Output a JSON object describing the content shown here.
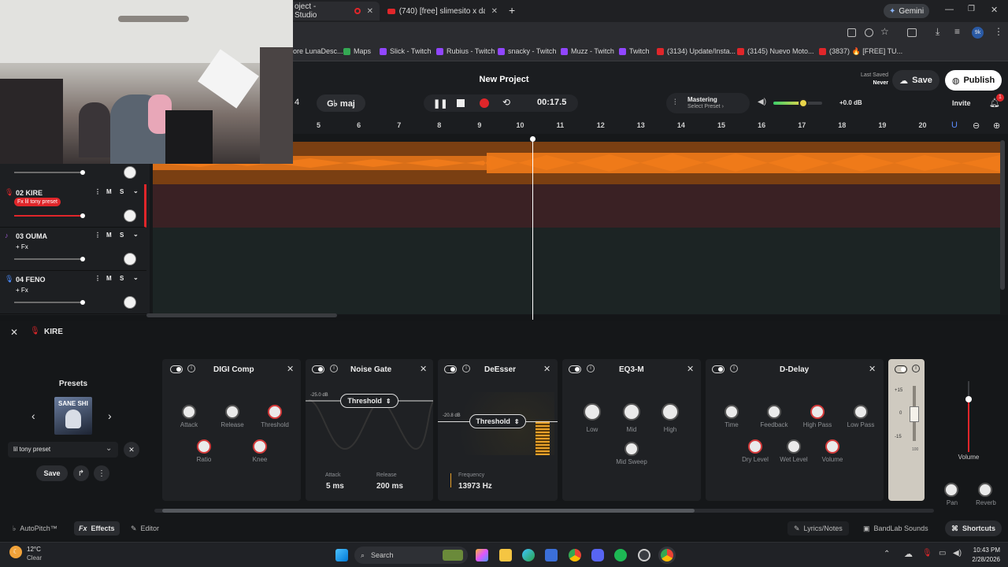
{
  "browser": {
    "tabs": [
      {
        "label": "oject - Studio",
        "active": true
      },
      {
        "label": "(740) [free] slimesito x dark plu",
        "active": false
      }
    ],
    "gemini_label": "Gemini",
    "profile_initials": "9k",
    "bookmarks": [
      "ore LunaDesc...",
      "Maps",
      "Slick - Twitch",
      "Rubius - Twitch",
      "snacky - Twitch",
      "Muzz - Twitch",
      "Twitch",
      "(3134) Update/Insta...",
      "(3145) Nuevo Moto...",
      "(3837) 🔥 [FREE] TU..."
    ]
  },
  "header": {
    "project_title": "New Project",
    "last_saved_label": "Last Saved",
    "last_saved_value": "Never",
    "save_label": "Save",
    "publish_label": "Publish",
    "invite_label": "Invite",
    "notif_count": "1",
    "bpm_partial": "4",
    "key": "G♭ maj",
    "time": "00:17.5",
    "mastering_label": "Mastering",
    "mastering_preset": "Select Preset ›",
    "volume_db": "+0.0 dB",
    "volume_level": 0.62
  },
  "ruler": {
    "marks": [
      "5",
      "6",
      "7",
      "8",
      "9",
      "10",
      "11",
      "12",
      "13",
      "14",
      "15",
      "16",
      "17",
      "18",
      "19",
      "20"
    ]
  },
  "tracks": [
    {
      "name": "02 KIRE",
      "fx": "Fx lil tony preset",
      "m": "M",
      "s": "S"
    },
    {
      "name": "03 OUMA",
      "fx": "+ Fx",
      "m": "M",
      "s": "S"
    },
    {
      "name": "04 FENO",
      "fx": "+ Fx",
      "m": "M",
      "s": "S"
    }
  ],
  "fx_panel": {
    "track_name": "KIRE",
    "presets_label": "Presets",
    "preset_name": "lil tony preset",
    "save_label": "Save",
    "cover_text": "SANE SHI",
    "effects": {
      "digicomp": {
        "title": "DIGI Comp",
        "knobs": [
          "Attack",
          "Release",
          "Threshold",
          "Ratio",
          "Knee"
        ]
      },
      "noisegate": {
        "title": "Noise Gate",
        "db": "-25.0 dB",
        "threshold_label": "Threshold",
        "attack_label": "Attack",
        "attack_value": "5 ms",
        "release_label": "Release",
        "release_value": "200 ms"
      },
      "deesser": {
        "title": "DeEsser",
        "db": "-20.8 dB",
        "threshold_label": "Threshold",
        "freq_label": "Frequency",
        "freq_value": "13973 Hz"
      },
      "eq3m": {
        "title": "EQ3-M",
        "knobs": [
          "Low",
          "Mid",
          "High",
          "Mid Sweep"
        ]
      },
      "ddelay": {
        "title": "D-Delay",
        "knobs": [
          "Time",
          "Feedback",
          "High Pass",
          "Low Pass",
          "Dry Level",
          "Wet Level",
          "Volume"
        ]
      }
    },
    "meter_labels": [
      "+15",
      "0",
      "-15",
      "100"
    ],
    "volume_label": "Volume",
    "pan_label": "Pan",
    "reverb_label": "Reverb"
  },
  "bottombar": {
    "autopitch": "AutoPitch™",
    "effects": "Effects",
    "editor": "Editor",
    "lyrics": "Lyrics/Notes",
    "sounds": "BandLab Sounds",
    "shortcuts": "Shortcuts"
  },
  "taskbar": {
    "weather_temp": "12°C",
    "weather_desc": "Clear",
    "search_label": "Search",
    "time": "10:43 PM",
    "date": "2/28/2026"
  },
  "colors": {
    "accent_orange": "#f07a1a",
    "record_red": "#e0262a",
    "lane_red": "#3a2124",
    "lane_dark": "#1c2424"
  }
}
